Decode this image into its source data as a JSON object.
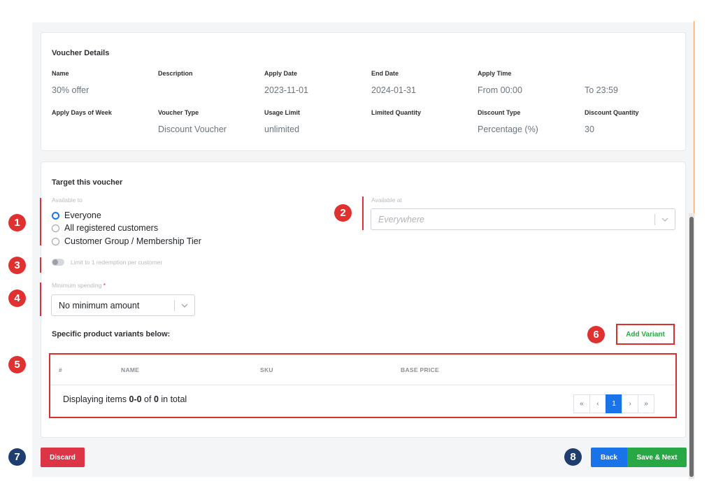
{
  "voucher_details": {
    "title": "Voucher Details",
    "row1": [
      {
        "label": "Name",
        "value": "30% offer"
      },
      {
        "label": "Description",
        "value": ""
      },
      {
        "label": "Apply Date",
        "value": "2023-11-01"
      },
      {
        "label": "End Date",
        "value": "2024-01-31"
      },
      {
        "label": "Apply Time",
        "value": "From 00:00"
      },
      {
        "label": "",
        "value": "To 23:59"
      }
    ],
    "row2": [
      {
        "label": "Apply Days of Week",
        "value": ""
      },
      {
        "label": "Voucher Type",
        "value": "Discount Voucher"
      },
      {
        "label": "Usage Limit",
        "value": "unlimited"
      },
      {
        "label": "Limited Quantity",
        "value": ""
      },
      {
        "label": "Discount Type",
        "value": "Percentage (%)"
      },
      {
        "label": "Discount Quantity",
        "value": "30"
      }
    ]
  },
  "target": {
    "title": "Target this voucher",
    "available_to_label": "Available to",
    "options": [
      "Everyone",
      "All registered customers",
      "Customer Group / Membership Tier"
    ],
    "selected_option": "Everyone",
    "available_at_label": "Available at",
    "available_at_placeholder": "Everywhere",
    "limit_toggle_label": "Limit to 1 redemption per customer",
    "limit_toggle_on": false,
    "min_spending_label": "Minimum spending",
    "min_spending_required_mark": "*",
    "min_spending_value": "No minimum amount",
    "variants_heading": "Specific product variants below:",
    "add_variant_label": "Add Variant"
  },
  "table": {
    "columns": [
      "#",
      "NAME",
      "SKU",
      "BASE PRICE"
    ],
    "footer_prefix": "Displaying items ",
    "footer_range": "0-0",
    "footer_mid": " of ",
    "footer_total": "0",
    "footer_suffix": " in total",
    "pager": {
      "first": "«",
      "prev": "‹",
      "current": "1",
      "next": "›",
      "last": "»"
    }
  },
  "actions": {
    "discard": "Discard",
    "back": "Back",
    "save_next": "Save & Next"
  },
  "annotations": {
    "b1": "1",
    "b2": "2",
    "b3": "3",
    "b4": "4",
    "b5": "5",
    "b6": "6",
    "b7": "7",
    "b8": "8"
  },
  "colors": {
    "annotation_red": "#e03131",
    "annotation_navy": "#1f3d6e",
    "primary": "#1a73e8",
    "success": "#28a745",
    "danger": "#dc3545"
  }
}
